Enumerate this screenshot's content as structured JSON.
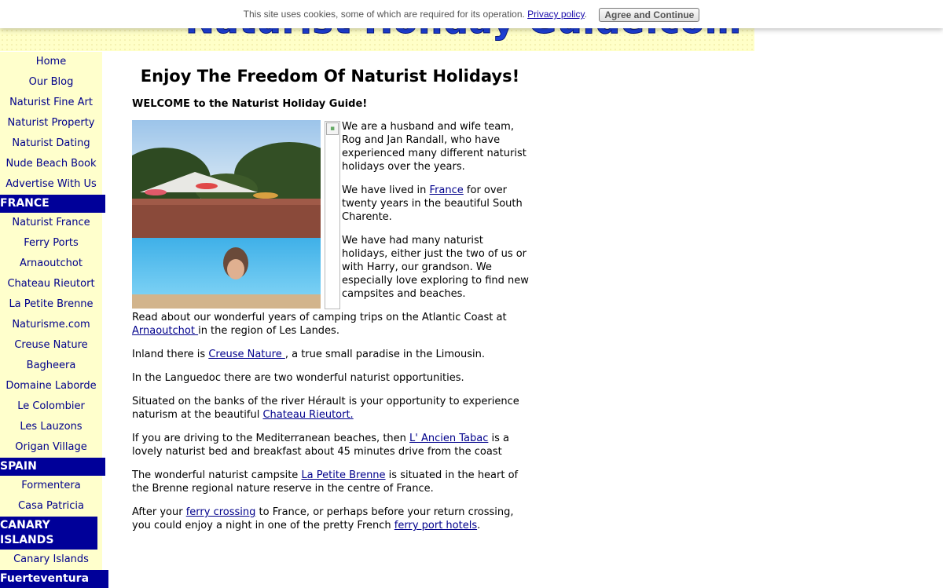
{
  "cookie_bar": {
    "message": "This site uses cookies, some of which are required for its operation.",
    "privacy_link": "Privacy policy",
    "period": ".",
    "agree_button": "Agree and Continue"
  },
  "header": {
    "logo_text": "Naturist Holiday Guide.com"
  },
  "sidebar": {
    "top_items": [
      "Home",
      "Our Blog",
      "Naturist Fine Art",
      "Naturist Property",
      "Naturist Dating",
      "Nude Beach Book",
      "Advertise With Us"
    ],
    "france_heading": "FRANCE",
    "france_items": [
      "Naturist France",
      "Ferry Ports",
      "Arnaoutchot",
      "Chateau Rieutort",
      "La Petite Brenne",
      "Naturisme.com",
      "Creuse Nature",
      "Bagheera",
      "Domaine Laborde",
      "Le Colombier",
      "Les Lauzons",
      "Origan Village"
    ],
    "spain_heading": "SPAIN",
    "spain_items": [
      "Formentera",
      "Casa Patricia"
    ],
    "canary_heading": "CANARY ISLANDS",
    "canary_items": [
      "Canary Islands"
    ],
    "next_heading": "Fuerteventura"
  },
  "main": {
    "title": "Enjoy The Freedom Of Naturist Holidays!",
    "welcome": "WELCOME to the Naturist Holiday Guide!",
    "p1": "We are a husband and wife team, Rog and Jan Randall, who have experienced many different naturist holidays over the years.",
    "p2_before": "We have lived in ",
    "p2_link": "France",
    "p2_after": " for over twenty years in the beautiful South Charente.",
    "p3": "We have had many naturist holidays, either just the two of us or with Harry, our grandson. We especially love exploring to find new campsites and beaches.",
    "p4_before": "Read about our wonderful years of camping trips on the Atlantic Coast at ",
    "p4_link": "Arnaoutchot ",
    "p4_after": "in the region of Les Landes.",
    "p5_before": "Inland there is ",
    "p5_link": "Creuse Nature ",
    "p5_after": ", a true small paradise in the Limousin.",
    "p6": "In the Languedoc there are two wonderful naturist opportunities.",
    "p7_before": "Situated on the banks of the river Hérault is your opportunity to experience naturism at the beautiful ",
    "p7_link": "Chateau Rieutort.",
    "p8_before": "If you are driving to the Mediterranean beaches, then ",
    "p8_link": "L' Ancien Tabac",
    "p8_after": " is a lovely naturist bed and breakfast about 45 minutes drive from the coast",
    "p9_before": "The wonderful naturist campsite ",
    "p9_link": "La Petite Brenne",
    "p9_after": " is situated in the heart of the Brenne regional nature reserve in the centre of France.",
    "p10_before": "After your ",
    "p10_link1": "ferry crossing",
    "p10_mid": " to France, or perhaps before your return crossing, you could enjoy a night in one of the pretty French ",
    "p10_link2": "ferry port hotels",
    "p10_after": "."
  },
  "colors": {
    "sidebar_bg": "#ffffcc",
    "section_heading_bg": "#000099",
    "link": "#00008b",
    "header_bg": "#ffffc8"
  }
}
